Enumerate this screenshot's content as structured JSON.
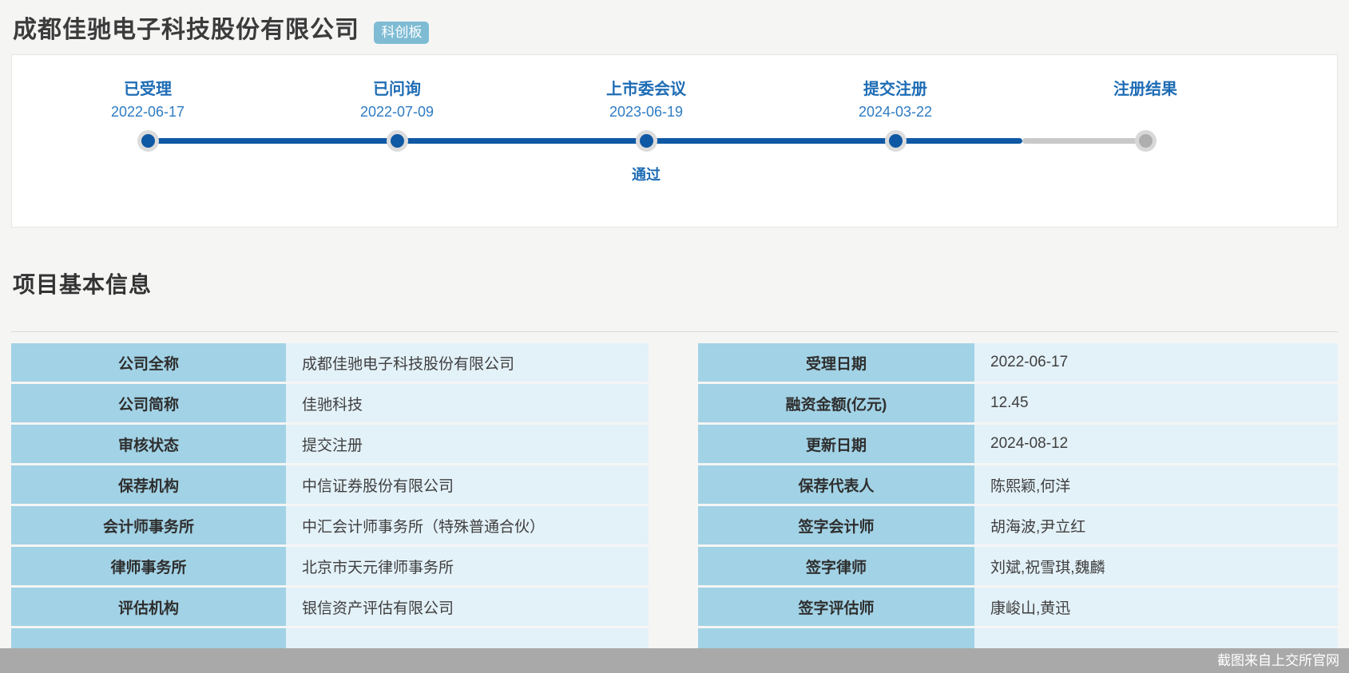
{
  "header": {
    "company_name": "成都佳驰电子科技股份有限公司",
    "board_badge": "科创板"
  },
  "timeline": {
    "stages": [
      {
        "name": "已受理",
        "date": "2022-06-17",
        "status": "completed"
      },
      {
        "name": "已问询",
        "date": "2022-07-09",
        "status": "completed"
      },
      {
        "name": "上市委会议",
        "date": "2023-06-19",
        "status": "completed",
        "result": "通过"
      },
      {
        "name": "提交注册",
        "date": "2024-03-22",
        "status": "completed"
      },
      {
        "name": "注册结果",
        "date": "",
        "status": "pending"
      }
    ]
  },
  "section_title": "项目基本信息",
  "info_table": {
    "left_rows": [
      {
        "label": "公司全称",
        "value": "成都佳驰电子科技股份有限公司"
      },
      {
        "label": "公司简称",
        "value": "佳驰科技"
      },
      {
        "label": "审核状态",
        "value": "提交注册"
      },
      {
        "label": "保荐机构",
        "value": "中信证券股份有限公司"
      },
      {
        "label": "会计师事务所",
        "value": "中汇会计师事务所（特殊普通合伙）"
      },
      {
        "label": "律师事务所",
        "value": "北京市天元律师事务所"
      },
      {
        "label": "评估机构",
        "value": "银信资产评估有限公司"
      }
    ],
    "right_rows": [
      {
        "label": "受理日期",
        "value": "2022-06-17"
      },
      {
        "label": "融资金额(亿元)",
        "value": "12.45"
      },
      {
        "label": "更新日期",
        "value": "2024-08-12"
      },
      {
        "label": "保荐代表人",
        "value": "陈熙颖,何洋"
      },
      {
        "label": "签字会计师",
        "value": "胡海波,尹立红"
      },
      {
        "label": "签字律师",
        "value": "刘斌,祝雪琪,魏麟"
      },
      {
        "label": "签字评估师",
        "value": "康峻山,黄迅"
      }
    ]
  },
  "footer": {
    "watermark": "截图来自上交所官网"
  },
  "colors": {
    "accent_blue": "#1e6cb5",
    "track_done": "#0f58a4",
    "track_pending": "#c9c9c9",
    "label_cell_bg": "#a2d2e5",
    "value_cell_bg": "#e3f1f8",
    "badge_bg": "#7fbcd4",
    "footer_bg": "#a9a9a9"
  }
}
